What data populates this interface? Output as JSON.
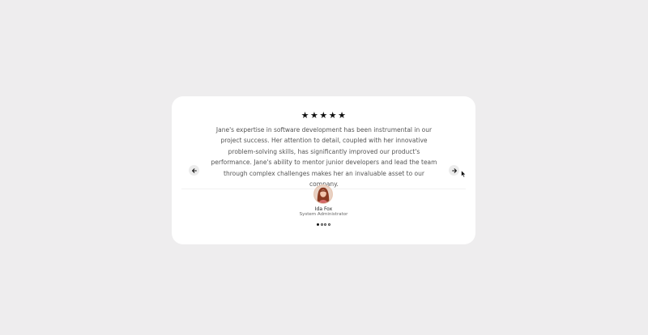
{
  "testimonial": {
    "rating": 5,
    "stars": [
      "★",
      "★",
      "★",
      "★",
      "★"
    ],
    "quote": "Jane's expertise in software development has been instrumental in our project success. Her attention to detail, coupled with her innovative problem-solving skills, has significantly improved our product's performance. Jane's ability to mentor junior developers and lead the team through complex challenges makes her an invaluable asset to our company.",
    "author_name": "Ida Fox",
    "author_role": "System Administrator"
  },
  "carousel": {
    "prev_icon": "arrow-left-icon",
    "next_icon": "arrow-right-icon",
    "total_slides": 4,
    "active_slide": 1
  },
  "colors": {
    "page_background": "#eeedee",
    "card_background": "#ffffff",
    "star_color": "#111111",
    "text_color": "#555555"
  }
}
